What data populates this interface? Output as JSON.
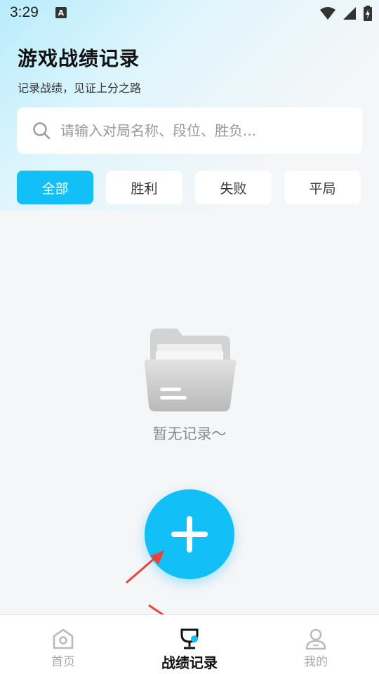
{
  "status_bar": {
    "time": "3:29",
    "indicator": "A"
  },
  "header": {
    "title": "游戏战绩记录",
    "subtitle": "记录战绩，见证上分之路"
  },
  "search": {
    "placeholder": "请输入对局名称、段位、胜负...",
    "value": "",
    "icon": "search-icon"
  },
  "filters": [
    {
      "label": "全部",
      "active": true
    },
    {
      "label": "胜利",
      "active": false
    },
    {
      "label": "失败",
      "active": false
    },
    {
      "label": "平局",
      "active": false
    }
  ],
  "empty_state": {
    "icon": "empty-folder-icon",
    "text": "暂无记录～"
  },
  "fab": {
    "icon": "plus-icon"
  },
  "bottom_nav": [
    {
      "label": "首页",
      "icon": "home-icon",
      "active": false
    },
    {
      "label": "战绩记录",
      "icon": "trophy-icon",
      "active": true
    },
    {
      "label": "我的",
      "icon": "user-icon",
      "active": false
    }
  ],
  "colors": {
    "accent": "#12c0f7",
    "annotation_arrow": "#e8443a"
  }
}
